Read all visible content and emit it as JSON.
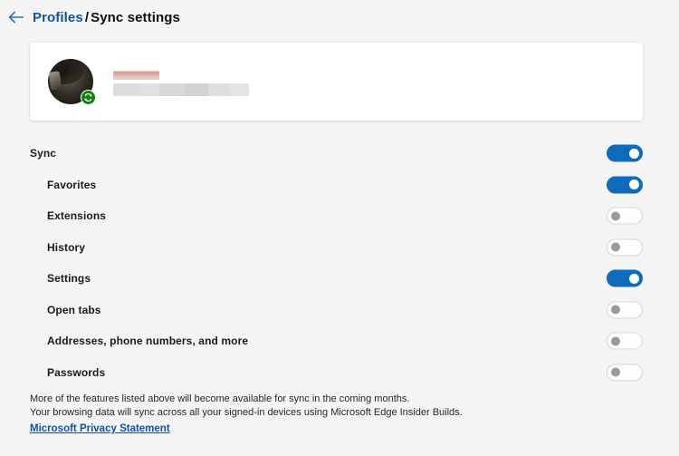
{
  "header": {
    "back_icon": "arrow-left-icon",
    "breadcrumb_parent": "Profiles",
    "breadcrumb_separator": "/",
    "breadcrumb_current": "Sync settings"
  },
  "profile": {
    "avatar_icon": "user-avatar-photo",
    "badge_icon": "sync-status-icon",
    "name_redacted": "",
    "email_redacted": ""
  },
  "sync_rows": [
    {
      "label": "Sync",
      "level": 0,
      "state": "on"
    },
    {
      "label": "Favorites",
      "level": 1,
      "state": "on"
    },
    {
      "label": "Extensions",
      "level": 1,
      "state": "off"
    },
    {
      "label": "History",
      "level": 1,
      "state": "off"
    },
    {
      "label": "Settings",
      "level": 1,
      "state": "on"
    },
    {
      "label": "Open tabs",
      "level": 1,
      "state": "off"
    },
    {
      "label": "Addresses, phone numbers, and more",
      "level": 1,
      "state": "off"
    },
    {
      "label": "Passwords",
      "level": 1,
      "state": "off"
    }
  ],
  "footer": {
    "line1": "More of the features listed above will become available for sync in the coming months.",
    "line2": "Your browsing data will sync across all your signed-in devices using Microsoft Edge Insider Builds.",
    "privacy_link": "Microsoft Privacy Statement"
  },
  "colors": {
    "accent_blue": "#0f6cbd",
    "link_blue": "#1352a2",
    "page_background": "#f4f4f4",
    "card_background": "#ffffff",
    "toggle_off_knob": "#9a9a9a",
    "badge_green": "#108010"
  }
}
